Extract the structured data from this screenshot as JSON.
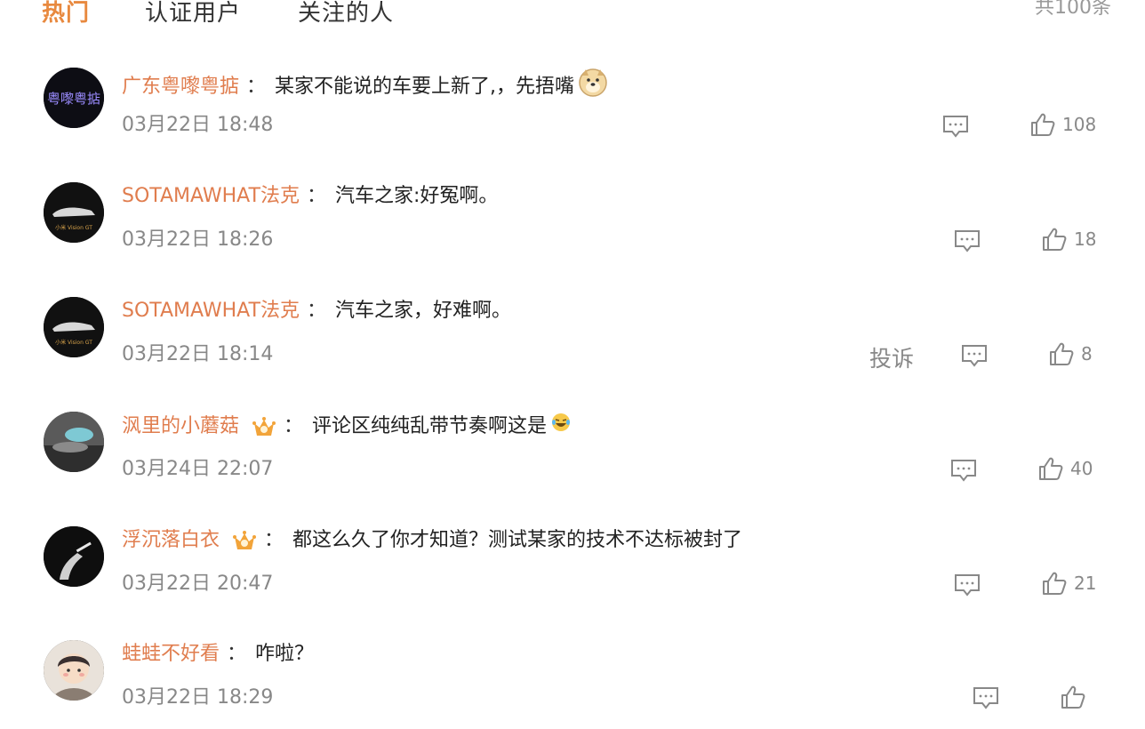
{
  "tabs": [
    {
      "label": "热门",
      "active": true
    },
    {
      "label": "认证用户",
      "active": false
    },
    {
      "label": "关注的人",
      "active": false
    }
  ],
  "total": "共100条",
  "colon": "：",
  "colors": {
    "accent": "#e8893f",
    "username": "#e07d4e",
    "muted": "#888888",
    "vip": "#f2a43a"
  },
  "comments": [
    {
      "username": "广东粤嚟粤掂",
      "text": "某家不能说的车要上新了,，先捂嘴",
      "emoji": "doge-emoji",
      "date": "03月22日 18:48",
      "likes": "108",
      "avatar_text": "粤嚟粤掂"
    },
    {
      "username": "SOTAMAWHAT法克",
      "text": "汽车之家:好冤啊。",
      "date": "03月22日 18:26",
      "likes": "18",
      "avatar_text": "小米 Vision GT"
    },
    {
      "username": "SOTAMAWHAT法克",
      "text": "汽车之家，好难啊。",
      "date": "03月22日 18:14",
      "likes": "8",
      "report": "投诉",
      "avatar_text": "小米 Vision GT"
    },
    {
      "username": "沨里的小蘑菇",
      "text": "评论区纯纯乱带节奏啊这是",
      "emoji": "laughing-tears-emoji",
      "vip": true,
      "date": "03月24日 22:07",
      "likes": "40"
    },
    {
      "username": "浮沉落白衣",
      "text": "都这么久了你才知道？测试某家的技术不达标被封了",
      "vip": true,
      "date": "03月22日 20:47",
      "likes": "21"
    },
    {
      "username": "蛙蛙不好看",
      "text": "咋啦？",
      "date": "03月22日 18:29",
      "likes": ""
    }
  ]
}
